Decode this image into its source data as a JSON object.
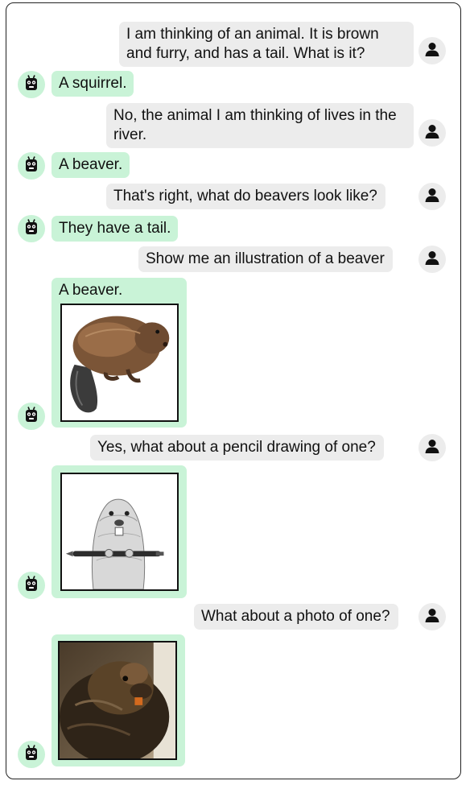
{
  "messages": {
    "m1": "I am thinking of an animal. It is brown and furry, and has a tail. What is it?",
    "m2": "A squirrel.",
    "m3": "No, the animal I am thinking of lives in the river.",
    "m4": "A beaver.",
    "m5": "That's right, what do beavers look like?",
    "m6": "They have a tail.",
    "m7": "Show me an illustration of a beaver",
    "m8": "A beaver.",
    "m9": "Yes, what about a pencil drawing of one?",
    "m11": "What about a photo of one?"
  },
  "images": {
    "illustration": "beaver-illustration",
    "pencil": "beaver-pencil-drawing",
    "photo": "beaver-photo"
  },
  "icons": {
    "user": "user-icon",
    "bot": "robot-icon"
  },
  "colors": {
    "user_bubble": "#ececec",
    "bot_bubble": "#c9f3d7"
  }
}
